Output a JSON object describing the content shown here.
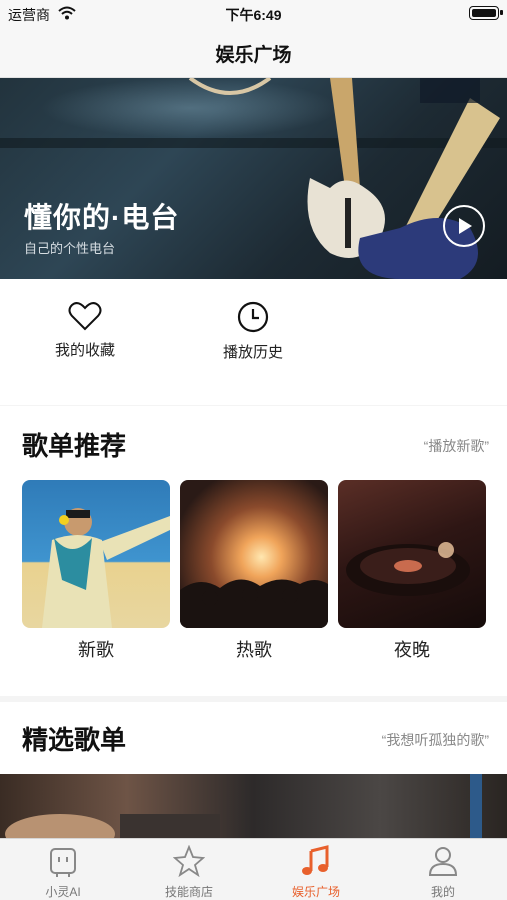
{
  "status_bar": {
    "carrier": "运营商",
    "time": "下午6:49"
  },
  "nav": {
    "title": "娱乐广场"
  },
  "banner": {
    "title": "懂你的·电台",
    "subtitle": "自己的个性电台"
  },
  "quick_actions": [
    {
      "label": "我的收藏",
      "icon": "heart-icon"
    },
    {
      "label": "播放历史",
      "icon": "clock-icon"
    }
  ],
  "playlist_section": {
    "title": "歌单推荐",
    "more": "“播放新歌”",
    "cards": [
      {
        "name": "新歌"
      },
      {
        "name": "热歌"
      },
      {
        "name": "夜晚"
      }
    ]
  },
  "featured_section": {
    "title": "精选歌单",
    "more": "“我想听孤独的歌”"
  },
  "tab_bar": {
    "active_color": "#e8602c",
    "tabs": [
      {
        "label": "小灵AI",
        "icon": "robot-icon"
      },
      {
        "label": "技能商店",
        "icon": "star-icon"
      },
      {
        "label": "娱乐广场",
        "icon": "music-note-icon"
      },
      {
        "label": "我的",
        "icon": "person-icon"
      }
    ]
  }
}
